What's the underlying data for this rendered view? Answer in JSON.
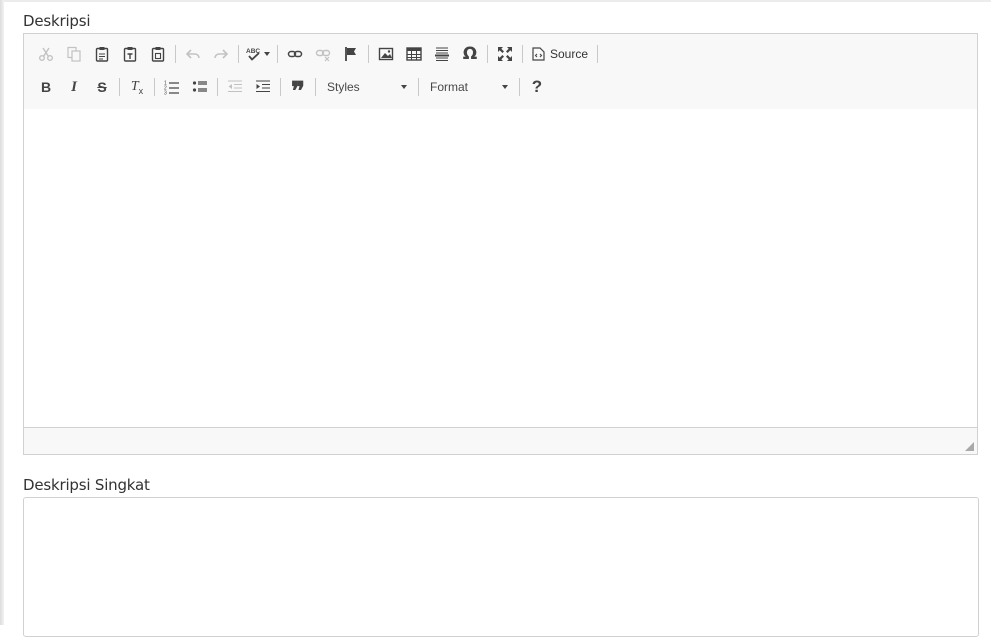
{
  "fields": {
    "description_label": "Deskripsi",
    "short_description_label": "Deskripsi Singkat"
  },
  "toolbar": {
    "source_label": "Source",
    "styles_label": "Styles",
    "format_label": "Format",
    "help_label": "?",
    "omega_label": "Ω",
    "bold_label": "B",
    "italic_label": "I",
    "strike_label": "S",
    "remove_format_label": "T",
    "remove_format_sub": "x",
    "quote_label": "❞"
  },
  "colors": {
    "toolbar_bg": "#f8f8f8",
    "border": "#d1d1d1",
    "icon": "#444444",
    "icon_disabled": "#c2c2c2"
  }
}
